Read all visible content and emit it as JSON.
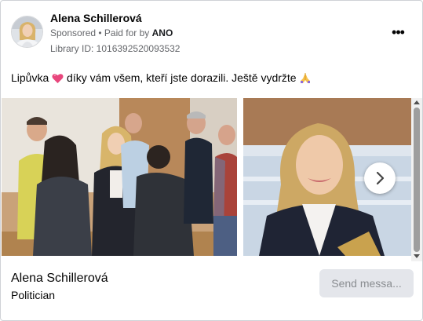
{
  "header": {
    "page_name": "Alena Schillerová",
    "sponsored": "Sponsored",
    "separator": " • ",
    "paid_for_prefix": "Paid for by ",
    "paid_for_by": "ANO",
    "library_id": "Library ID: 1016392520093532",
    "more_icon": "more-horizontal-icon",
    "more_label": "•••"
  },
  "post": {
    "text_part1": "Lipůvka",
    "text_part2": "díky vám všem, kteří jste dorazili. Ještě vydržte",
    "emoji_1": "pink-heart-emoji",
    "emoji_2": "folded-hands-emoji"
  },
  "carousel": {
    "images": [
      "group-meeting-photo",
      "portrait-photo"
    ],
    "next_icon": "chevron-right-icon"
  },
  "footer": {
    "name": "Alena Schillerová",
    "category": "Politician",
    "send_button": "Send messa..."
  },
  "colors": {
    "secondary_text": "#65676b",
    "button_bg": "#e4e6eb",
    "button_text": "#8a8d91",
    "heart": "#e8467c",
    "border": "#cfd2d6"
  }
}
